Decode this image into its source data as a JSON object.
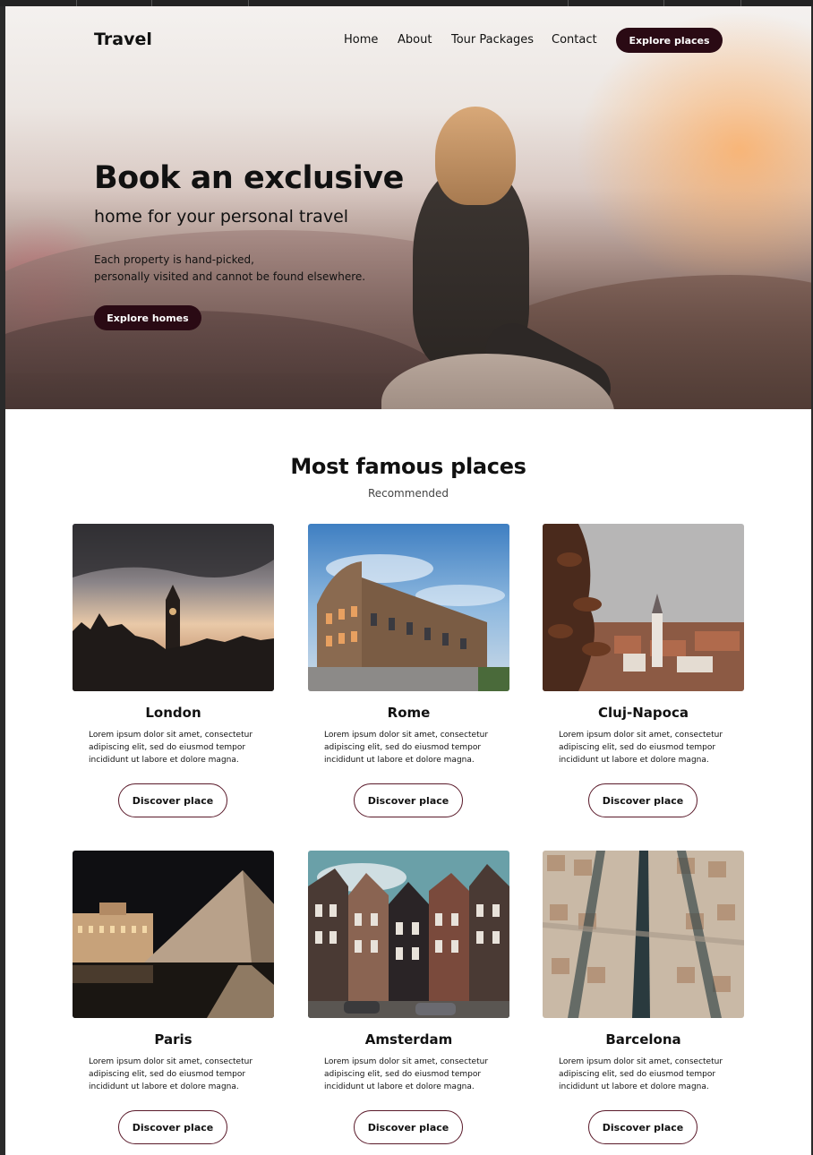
{
  "header": {
    "brand": "Travel",
    "nav": [
      "Home",
      "About",
      "Tour Packages",
      "Contact"
    ],
    "cta_label": "Explore places"
  },
  "hero": {
    "title": "Book an exclusive",
    "subtitle": "home for your personal travel",
    "desc_line1": "Each property is hand-picked,",
    "desc_line2": "personally visited and cannot be found elsewhere.",
    "button_label": "Explore homes"
  },
  "section": {
    "title": "Most famous places",
    "subtitle": "Recommended"
  },
  "places": [
    {
      "name": "London",
      "desc": "Lorem ipsum dolor sit amet, consectetur adipiscing elit, sed do eiusmod tempor incididunt ut labore et dolore magna.",
      "button": "Discover place"
    },
    {
      "name": "Rome",
      "desc": "Lorem ipsum dolor sit amet, consectetur adipiscing elit, sed do eiusmod tempor incididunt ut labore et dolore magna.",
      "button": "Discover place"
    },
    {
      "name": "Cluj-Napoca",
      "desc": "Lorem ipsum dolor sit amet, consectetur adipiscing elit, sed do eiusmod tempor incididunt ut labore et dolore magna.",
      "button": "Discover place"
    },
    {
      "name": "Paris",
      "desc": "Lorem ipsum dolor sit amet, consectetur adipiscing elit, sed do eiusmod tempor incididunt ut labore et dolore magna.",
      "button": "Discover place"
    },
    {
      "name": "Amsterdam",
      "desc": "Lorem ipsum dolor sit amet, consectetur adipiscing elit, sed do eiusmod tempor incididunt ut labore et dolore magna.",
      "button": "Discover place"
    },
    {
      "name": "Barcelona",
      "desc": "Lorem ipsum dolor sit amet, consectetur adipiscing elit, sed do eiusmod tempor incididunt ut labore et dolore magna.",
      "button": "Discover place"
    }
  ],
  "colors": {
    "accent": "#2a0a14",
    "button_border": "#5a1a2a",
    "text": "#111111"
  }
}
